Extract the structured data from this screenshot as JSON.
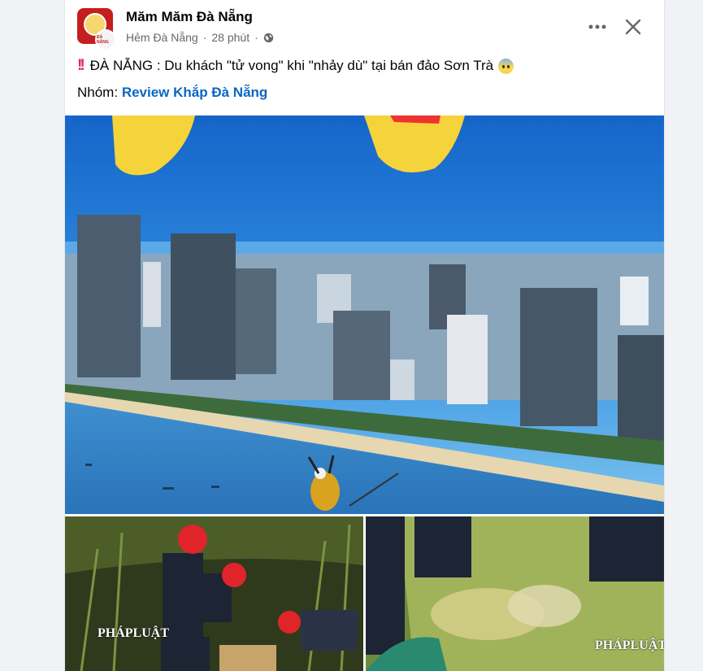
{
  "post": {
    "page_name": "Măm Măm Đà Nẵng",
    "location": "Hẻm Đà Nẵng",
    "time": "28 phút",
    "separator": "·",
    "visibility_icon": "globe-icon",
    "alert_icon": "double-exclamation-icon",
    "text": "ĐÀ NẴNG : Du khách \"tử vong\" khi \"nhảy dù\" tại bán đảo Sơn Trà",
    "emoji_icon": "anxious-face-icon",
    "group_prefix": "Nhóm:",
    "group_name": "Review Khắp Đà Nẵng",
    "avatar_sub_text": "ĐÀ NẴNG"
  },
  "actions": {
    "more_icon": "more-dots-icon",
    "close_icon": "close-icon"
  },
  "photos": {
    "watermark_left": "PHÁPLUẬT",
    "watermark_right": "PHÁPLUẬT"
  },
  "colors": {
    "link": "#0a66c2",
    "sky": "#1e90e8",
    "canopy": "#f5d33a"
  }
}
